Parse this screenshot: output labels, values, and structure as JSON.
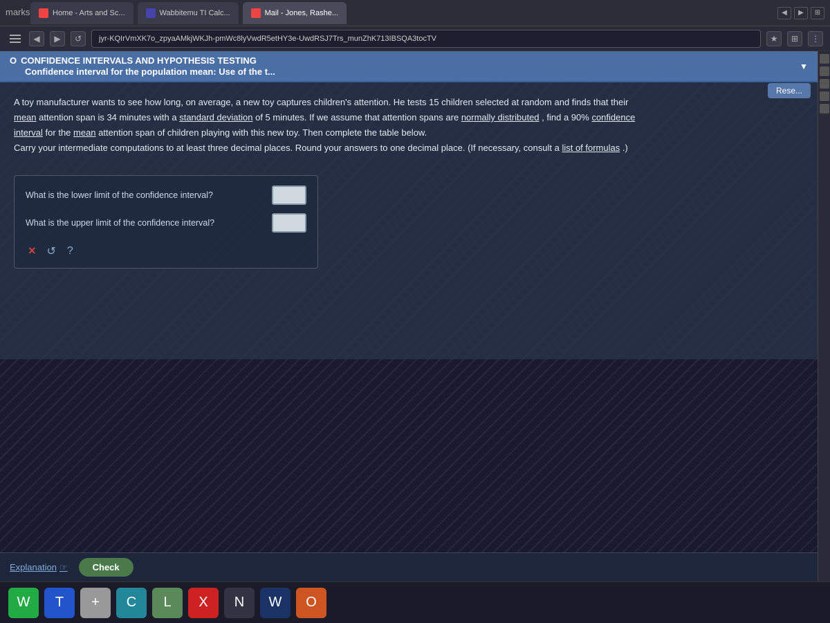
{
  "browser": {
    "tabs": [
      {
        "id": "home",
        "label": "Home - Arts and Sc...",
        "icon_color": "#e44",
        "active": false
      },
      {
        "id": "wabbitemu",
        "label": "Wabbitemu TI Calc...",
        "icon_color": "#44a",
        "active": false
      },
      {
        "id": "mail",
        "label": "Mail - Jones, Rashe...",
        "icon_color": "#e44",
        "active": true
      }
    ],
    "url": "jyr-KQIrVmXK7o_zpyaAMkjWKJh-pmWc8lyVwdR5etHY3e-UwdRSJ7Trs_munZhK713IBSQA3tocTV"
  },
  "marks_label": "marks",
  "section": {
    "icon_label": "O",
    "header_line1": "CONFIDENCE INTERVALS AND HYPOTHESIS TESTING",
    "header_line2": "Confidence interval for the population mean: Use of the t..."
  },
  "problem": {
    "text1": "A toy manufacturer wants to see how long, on average, a new toy captures children's attention. He tests 15 children selected at random and finds that their",
    "text2": "mean attention span is 34 minutes with a standard deviation of 5 minutes. If we assume that attention spans are normally distributed, find a 90% confidence",
    "text3": "interval for the mean attention span of children playing with this new toy. Then complete the table below.",
    "text4": "Carry your intermediate computations to at least three decimal places. Round your answers to one decimal place. (If necessary, consult a list of formulas.)"
  },
  "questions": [
    {
      "label": "What is the lower limit of the confidence interval?",
      "placeholder": ""
    },
    {
      "label": "What is the upper limit of the confidence interval?",
      "placeholder": ""
    }
  ],
  "buttons": {
    "x_label": "×",
    "undo_label": "↺",
    "question_label": "?",
    "reset_label": "Rese...",
    "explanation_label": "Explanation",
    "check_label": "Check"
  },
  "taskbar": {
    "items": [
      {
        "label": "W",
        "color_class": "green"
      },
      {
        "label": "T",
        "color_class": "blue"
      },
      {
        "label": "C",
        "color_class": "teal"
      },
      {
        "label": "L",
        "color_class": "orange"
      },
      {
        "label": "X",
        "color_class": "red"
      },
      {
        "label": "N",
        "color_class": "dark"
      },
      {
        "label": "W",
        "color_class": "navy"
      },
      {
        "label": "O",
        "color_class": "orange"
      }
    ]
  },
  "sidebar_right": {
    "icons": [
      "block1",
      "block2",
      "block3",
      "block4",
      "block5"
    ]
  }
}
